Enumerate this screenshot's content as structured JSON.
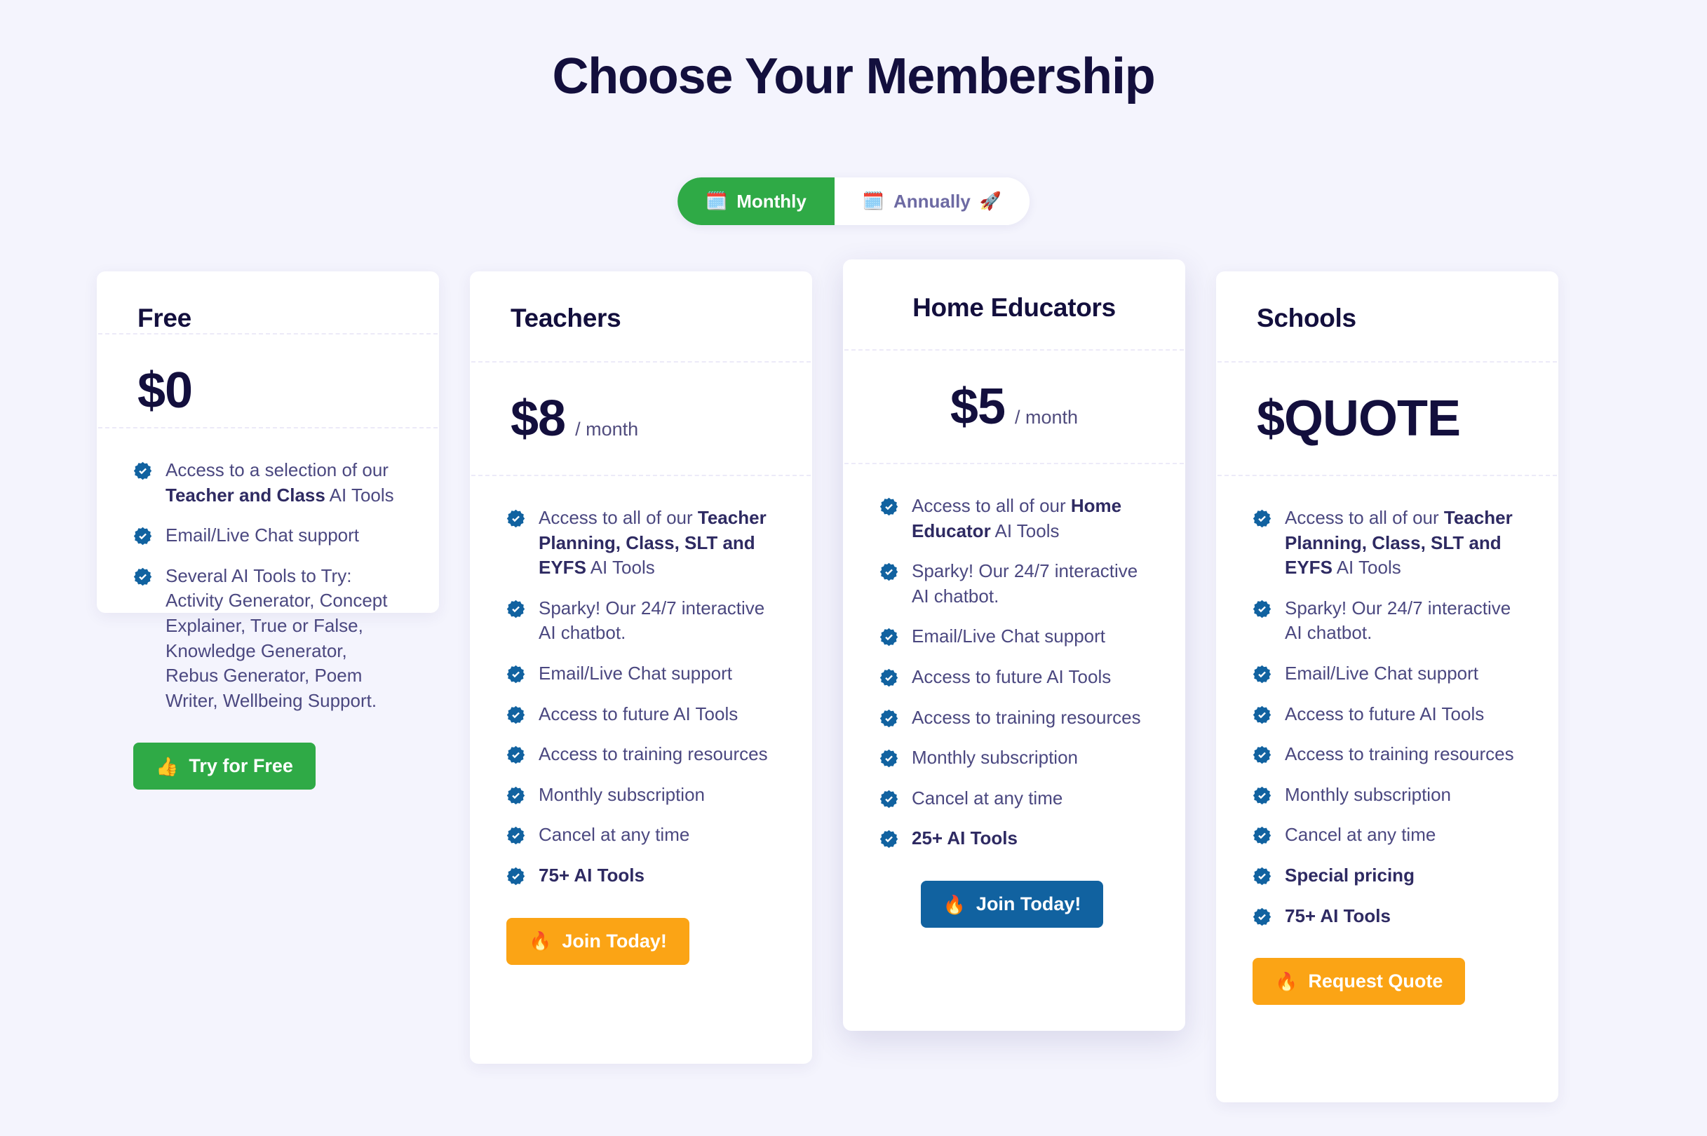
{
  "header": {
    "title": "Choose Your Membership"
  },
  "billing_toggle": {
    "monthly": {
      "label": "Monthly",
      "icon": "calendar-icon",
      "glyph": "🗓️",
      "active": true
    },
    "annually": {
      "label": "Annually",
      "icon": "calendar-icon",
      "glyph": "🗓️",
      "suffix_icon": "rocket-icon",
      "suffix_glyph": "🚀",
      "active": false
    }
  },
  "colors": {
    "page_background": "#f4f4fd",
    "card_background": "#ffffff",
    "heading": "#130f3d",
    "feature_text": "#4b4880",
    "check_badge": "#1162a0",
    "green": "#2faa46",
    "orange": "#fba415",
    "blue": "#1162a0"
  },
  "plans": [
    {
      "name": "Free",
      "price_amount": "$0",
      "price_period": "",
      "features": [
        {
          "html": "Access to a selection of our <b>Teacher and Class</b> AI Tools",
          "bold": false
        },
        {
          "html": "Email/Live Chat support",
          "bold": false
        },
        {
          "html": "Several AI Tools to Try: Activity Generator, Concept Explainer, True or False, Knowledge Generator, Rebus Generator, Poem Writer, Wellbeing Support.",
          "bold": false
        }
      ],
      "cta": {
        "label": "Try for Free",
        "icon": "thumbs-up-icon",
        "glyph": "👍",
        "style": "green"
      }
    },
    {
      "name": "Teachers",
      "price_amount": "$8",
      "price_period": "/ month",
      "features": [
        {
          "html": "Access to all of our <b>Teacher Planning, Class, SLT and EYFS</b> AI Tools",
          "bold": false
        },
        {
          "html": "Sparky! Our 24/7 interactive AI chatbot.",
          "bold": false
        },
        {
          "html": "Email/Live Chat support",
          "bold": false
        },
        {
          "html": "Access to future AI Tools",
          "bold": false
        },
        {
          "html": "Access to training resources",
          "bold": false
        },
        {
          "html": "Monthly subscription",
          "bold": false
        },
        {
          "html": "Cancel at any time",
          "bold": false
        },
        {
          "html": "75+ AI Tools",
          "bold": true
        }
      ],
      "cta": {
        "label": "Join Today!",
        "icon": "fire-icon",
        "glyph": "🔥",
        "style": "orange"
      }
    },
    {
      "name": "Home Educators",
      "price_amount": "$5",
      "price_period": "/ month",
      "featured": true,
      "features": [
        {
          "html": "Access to all of our <b>Home Educator</b> AI Tools",
          "bold": false
        },
        {
          "html": "Sparky! Our 24/7 interactive AI chatbot.",
          "bold": false
        },
        {
          "html": "Email/Live Chat support",
          "bold": false
        },
        {
          "html": "Access to future AI Tools",
          "bold": false
        },
        {
          "html": "Access to training resources",
          "bold": false
        },
        {
          "html": "Monthly subscription",
          "bold": false
        },
        {
          "html": "Cancel at any time",
          "bold": false
        },
        {
          "html": "25+ AI Tools",
          "bold": true
        }
      ],
      "cta": {
        "label": "Join Today!",
        "icon": "fire-icon",
        "glyph": "🔥",
        "style": "blue"
      }
    },
    {
      "name": "Schools",
      "price_amount": "$QUOTE",
      "price_period": "",
      "features": [
        {
          "html": "Access to all of our <b>Teacher Planning, Class, SLT and EYFS</b> AI Tools",
          "bold": false
        },
        {
          "html": "Sparky! Our 24/7 interactive AI chatbot.",
          "bold": false
        },
        {
          "html": "Email/Live Chat support",
          "bold": false
        },
        {
          "html": "Access to future AI Tools",
          "bold": false
        },
        {
          "html": "Access to training resources",
          "bold": false
        },
        {
          "html": "Monthly subscription",
          "bold": false
        },
        {
          "html": "Cancel at any time",
          "bold": false
        },
        {
          "html": "Special pricing",
          "bold": true
        },
        {
          "html": "75+ AI Tools",
          "bold": true
        }
      ],
      "cta": {
        "label": "Request Quote",
        "icon": "fire-icon",
        "glyph": "🔥",
        "style": "orange"
      }
    }
  ]
}
